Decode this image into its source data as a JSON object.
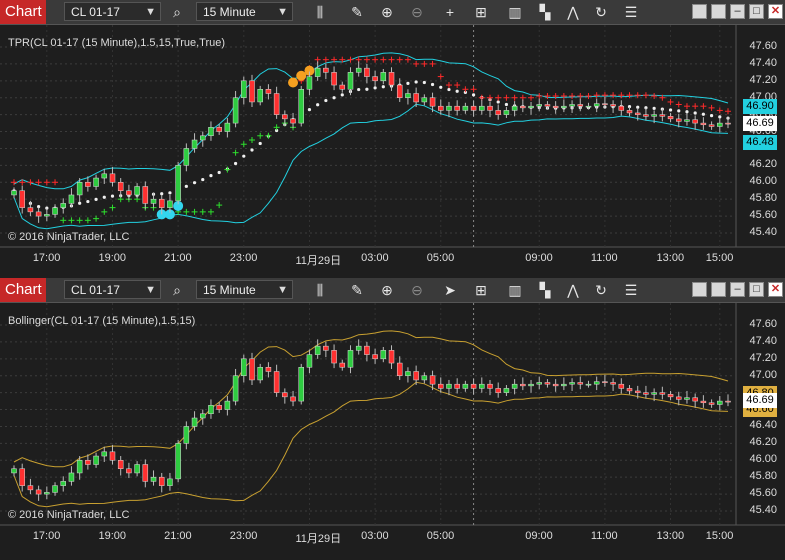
{
  "top": {
    "title": "Chart",
    "instrument": "CL 01-17",
    "interval": "15 Minute",
    "indicator": "TPR(CL 01-17 (15 Minute),1.5,15,True,True)",
    "copyright": "© 2016 NinjaTrader, LLC",
    "y_ticks": [
      "47.60",
      "47.40",
      "47.20",
      "47.00",
      "46.80",
      "46.60",
      "46.40",
      "46.20",
      "46.00",
      "45.80",
      "45.60",
      "45.40"
    ],
    "x_ticks": [
      "17:00",
      "19:00",
      "21:00",
      "23:00",
      "11月29日",
      "03:00",
      "05:00",
      "09:00",
      "11:00",
      "13:00",
      "15:00"
    ],
    "badges": {
      "upper": "46.90",
      "last": "46.69",
      "lower": "46.48"
    },
    "colors": {
      "band": "#22d0e0",
      "trail": "#ff2020",
      "badge": "#22d0e0"
    }
  },
  "bottom": {
    "title": "Chart",
    "instrument": "CL 01-17",
    "interval": "15 Minute",
    "indicator": "Bollinger(CL 01-17 (15 Minute),1.5,15)",
    "copyright": "© 2016 NinjaTrader, LLC",
    "y_ticks": [
      "47.60",
      "47.40",
      "47.20",
      "47.00",
      "46.80",
      "46.60",
      "46.40",
      "46.20",
      "46.00",
      "45.80",
      "45.60",
      "45.40"
    ],
    "x_ticks": [
      "17:00",
      "19:00",
      "21:00",
      "23:00",
      "11月29日",
      "03:00",
      "05:00",
      "09:00",
      "11:00",
      "13:00",
      "15:00"
    ],
    "badges": {
      "upper": "46.80",
      "last": "46.69",
      "lower": "46.60"
    },
    "colors": {
      "band": "#c8a030",
      "badge": "#e0b040"
    }
  },
  "chart_data": {
    "type": "candlestick",
    "instrument": "CL 01-17",
    "interval": "15 Minute",
    "ylim": [
      45.4,
      47.6
    ],
    "closes": [
      45.9,
      45.7,
      45.65,
      45.6,
      45.62,
      45.7,
      45.75,
      45.85,
      46.0,
      45.95,
      46.05,
      46.1,
      46.0,
      45.9,
      45.85,
      45.95,
      45.75,
      45.8,
      45.7,
      45.78,
      46.2,
      46.4,
      46.5,
      46.55,
      46.65,
      46.6,
      46.7,
      47.0,
      47.2,
      46.95,
      47.1,
      47.05,
      46.8,
      46.75,
      46.7,
      47.1,
      47.25,
      47.35,
      47.3,
      47.15,
      47.1,
      47.3,
      47.35,
      47.25,
      47.2,
      47.3,
      47.15,
      47.0,
      47.05,
      46.95,
      47.0,
      46.9,
      46.85,
      46.9,
      46.85,
      46.9,
      46.85,
      46.9,
      46.85,
      46.8,
      46.85,
      46.9,
      46.88,
      46.9,
      46.92,
      46.9,
      46.88,
      46.9,
      46.92,
      46.9,
      46.9,
      46.93,
      46.92,
      46.9,
      46.85,
      46.82,
      46.8,
      46.78,
      46.8,
      46.78,
      46.75,
      46.72,
      46.74,
      46.7,
      46.68,
      46.66,
      46.7,
      46.69
    ],
    "last": 46.69
  }
}
